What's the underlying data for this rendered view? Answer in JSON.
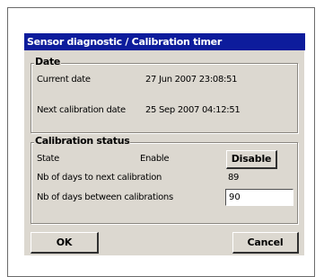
{
  "window": {
    "title": "Sensor diagnostic / Calibration timer"
  },
  "date_group": {
    "legend": "Date",
    "current_date_label": "Current date",
    "current_date_value": "27 Jun 2007 23:08:51",
    "next_calibration_label": "Next calibration date",
    "next_calibration_value": "25 Sep 2007 04:12:51"
  },
  "calibration_group": {
    "legend": "Calibration status",
    "state_label": "State",
    "state_value": "Enable",
    "disable_button": "Disable",
    "days_to_next_label": "Nb of days to next calibration",
    "days_to_next_value": "89",
    "days_between_label": "Nb of days between calibrations",
    "days_between_value": "90"
  },
  "buttons": {
    "ok": "OK",
    "cancel": "Cancel"
  },
  "colors": {
    "titlebar": "#0d1c9c",
    "dialog_background": "#dcd8d0"
  }
}
